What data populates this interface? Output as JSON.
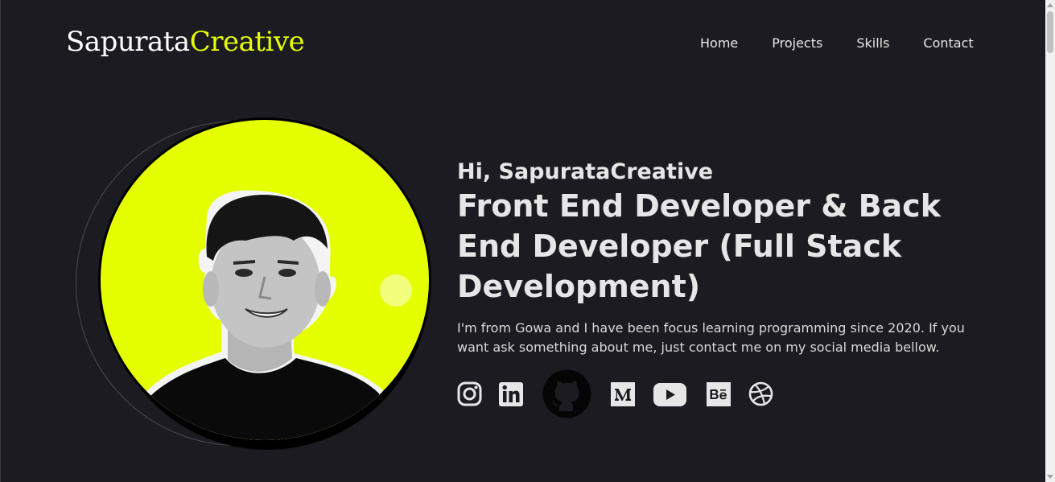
{
  "header": {
    "logo_part1": "Sapurata",
    "logo_part2": "Creative",
    "nav": [
      "Home",
      "Projects",
      "Skills",
      "Contact"
    ]
  },
  "hero": {
    "greeting": "Hi, SapurataCreative",
    "headline": "Front End Developer & Back End Developer (Full Stack Development)",
    "bio": "I'm from Gowa and I have been focus learning programming since 2020. If you want ask something about me, just contact me on my social media bellow.",
    "portrait": "profile-photo"
  },
  "social_icons": [
    "instagram-icon",
    "linkedin-icon",
    "github-icon",
    "medium-icon",
    "youtube-icon",
    "behance-icon",
    "dribbble-icon"
  ],
  "colors": {
    "background": "#1c1b21",
    "accent": "#e6ff00",
    "text": "#e6e6e6"
  }
}
